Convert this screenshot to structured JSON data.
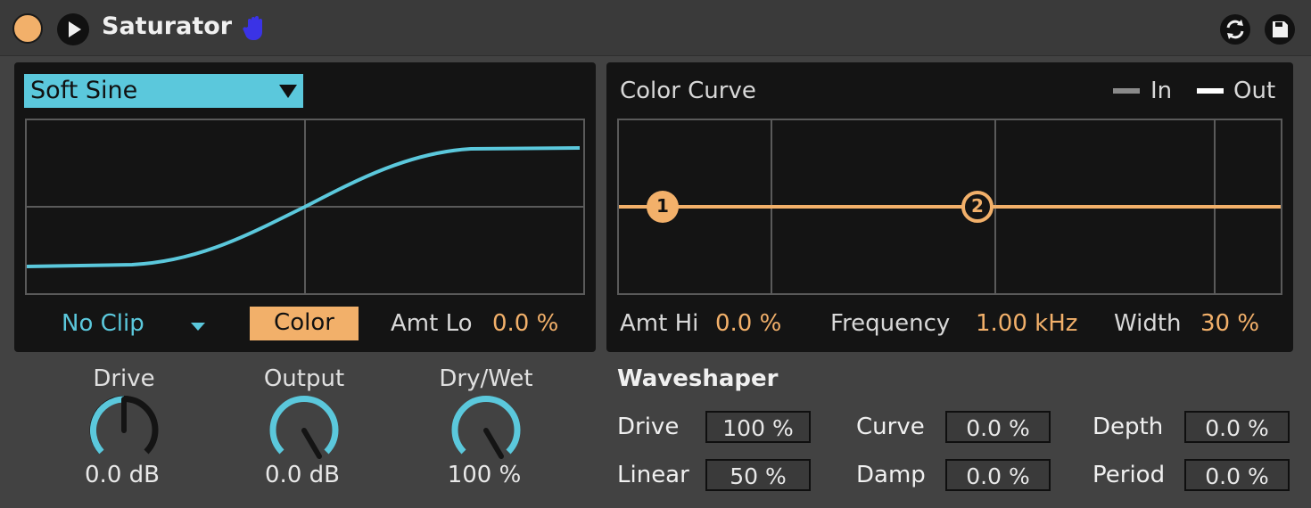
{
  "device": {
    "title": "Saturator"
  },
  "colors": {
    "accent_blue": "#5bc8dc",
    "accent_orange": "#f2b06a",
    "power_orange": "#f2b06a",
    "hand_icon": "#3a33e6"
  },
  "icons": {
    "power": "power-button-icon",
    "play": "play-icon",
    "hand": "hand-icon",
    "refresh": "refresh-icon",
    "save": "save-icon"
  },
  "shaper": {
    "type_selected": "Soft Sine",
    "clip_mode": "No Clip",
    "color_button": "Color",
    "amt_lo_label": "Amt Lo",
    "amt_lo_value": "0.0 %"
  },
  "color_curve": {
    "title": "Color Curve",
    "legend_in": "In",
    "legend_out": "Out",
    "node1": "1",
    "node2": "2",
    "amt_hi_label": "Amt Hi",
    "amt_hi_value": "0.0 %",
    "frequency_label": "Frequency",
    "frequency_value": "1.00 kHz",
    "width_label": "Width",
    "width_value": "30 %"
  },
  "knobs": [
    {
      "label": "Drive",
      "value": "0.0 dB"
    },
    {
      "label": "Output",
      "value": "0.0 dB"
    },
    {
      "label": "Dry/Wet",
      "value": "100 %"
    }
  ],
  "waveshaper": {
    "title": "Waveshaper",
    "drive_label": "Drive",
    "drive_value": "100 %",
    "linear_label": "Linear",
    "linear_value": "50 %",
    "curve_label": "Curve",
    "curve_value": "0.0 %",
    "damp_label": "Damp",
    "damp_value": "0.0 %",
    "depth_label": "Depth",
    "depth_value": "0.0 %",
    "period_label": "Period",
    "period_value": "0.0 %"
  }
}
